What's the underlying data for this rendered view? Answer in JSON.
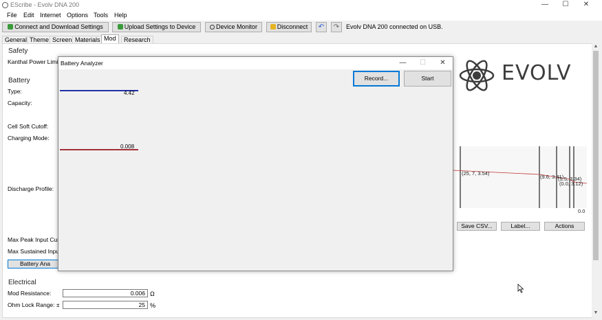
{
  "window": {
    "title": "EScribe - Evolv DNA 200",
    "minimize": "—",
    "maximize": "☐",
    "close": "✕"
  },
  "menu": [
    "File",
    "Edit",
    "Internet",
    "Options",
    "Tools",
    "Help"
  ],
  "toolbar": {
    "connect": "Connect and Download Settings",
    "upload": "Upload Settings to Device",
    "monitor": "Device Monitor",
    "disconnect": "Disconnect",
    "undo_icon": "undo-icon",
    "redo_icon": "redo-icon",
    "status": "Evolv DNA 200 connected on USB."
  },
  "tabs": [
    "General",
    "Theme",
    "Screen",
    "Materials",
    "Mod",
    "Research"
  ],
  "active_tab": "Mod",
  "mod": {
    "safety_header": "Safety",
    "kanthal_label": "Kanthal Power Limit",
    "battery_header": "Battery",
    "type_label": "Type:",
    "capacity_label": "Capacity:",
    "cell_soft_cutoff_label": "Cell Soft Cutoff:",
    "charging_mode_label": "Charging Mode:",
    "discharge_profile_label": "Discharge Profile:",
    "max_peak_label": "Max Peak Input Curr",
    "max_sustained_label": "Max Sustained Input",
    "battery_analyzer_button": "Battery Ana",
    "electrical_header": "Electrical",
    "mod_resistance_label": "Mod Resistance:",
    "mod_resistance_value": "0.006",
    "mod_resistance_unit": "Ω",
    "ohm_lock_label": "Ohm Lock Range: ±",
    "ohm_lock_value": "25",
    "ohm_lock_unit": "%"
  },
  "logo": {
    "text": "EVOLV",
    "icon": "atom-logo-icon"
  },
  "discharge_chart": {
    "labels": [
      "(25, 7, 3.54)",
      "(9.6, 3.41)",
      "(1.5, 3.34)",
      "(0.0, 3.12)"
    ],
    "axis_zero": "0.0",
    "save_csv": "Save CSV...",
    "label": "Label...",
    "actions": "Actions"
  },
  "dialog": {
    "title": "Battery Analyzer",
    "minimize": "—",
    "maximize": "☐",
    "close": "✕",
    "record": "Record...",
    "start": "Start",
    "meter1_value": "4.42",
    "meter1_color": "#1f2fa8",
    "meter2_value": "0.008",
    "meter2_color": "#a3303a"
  }
}
